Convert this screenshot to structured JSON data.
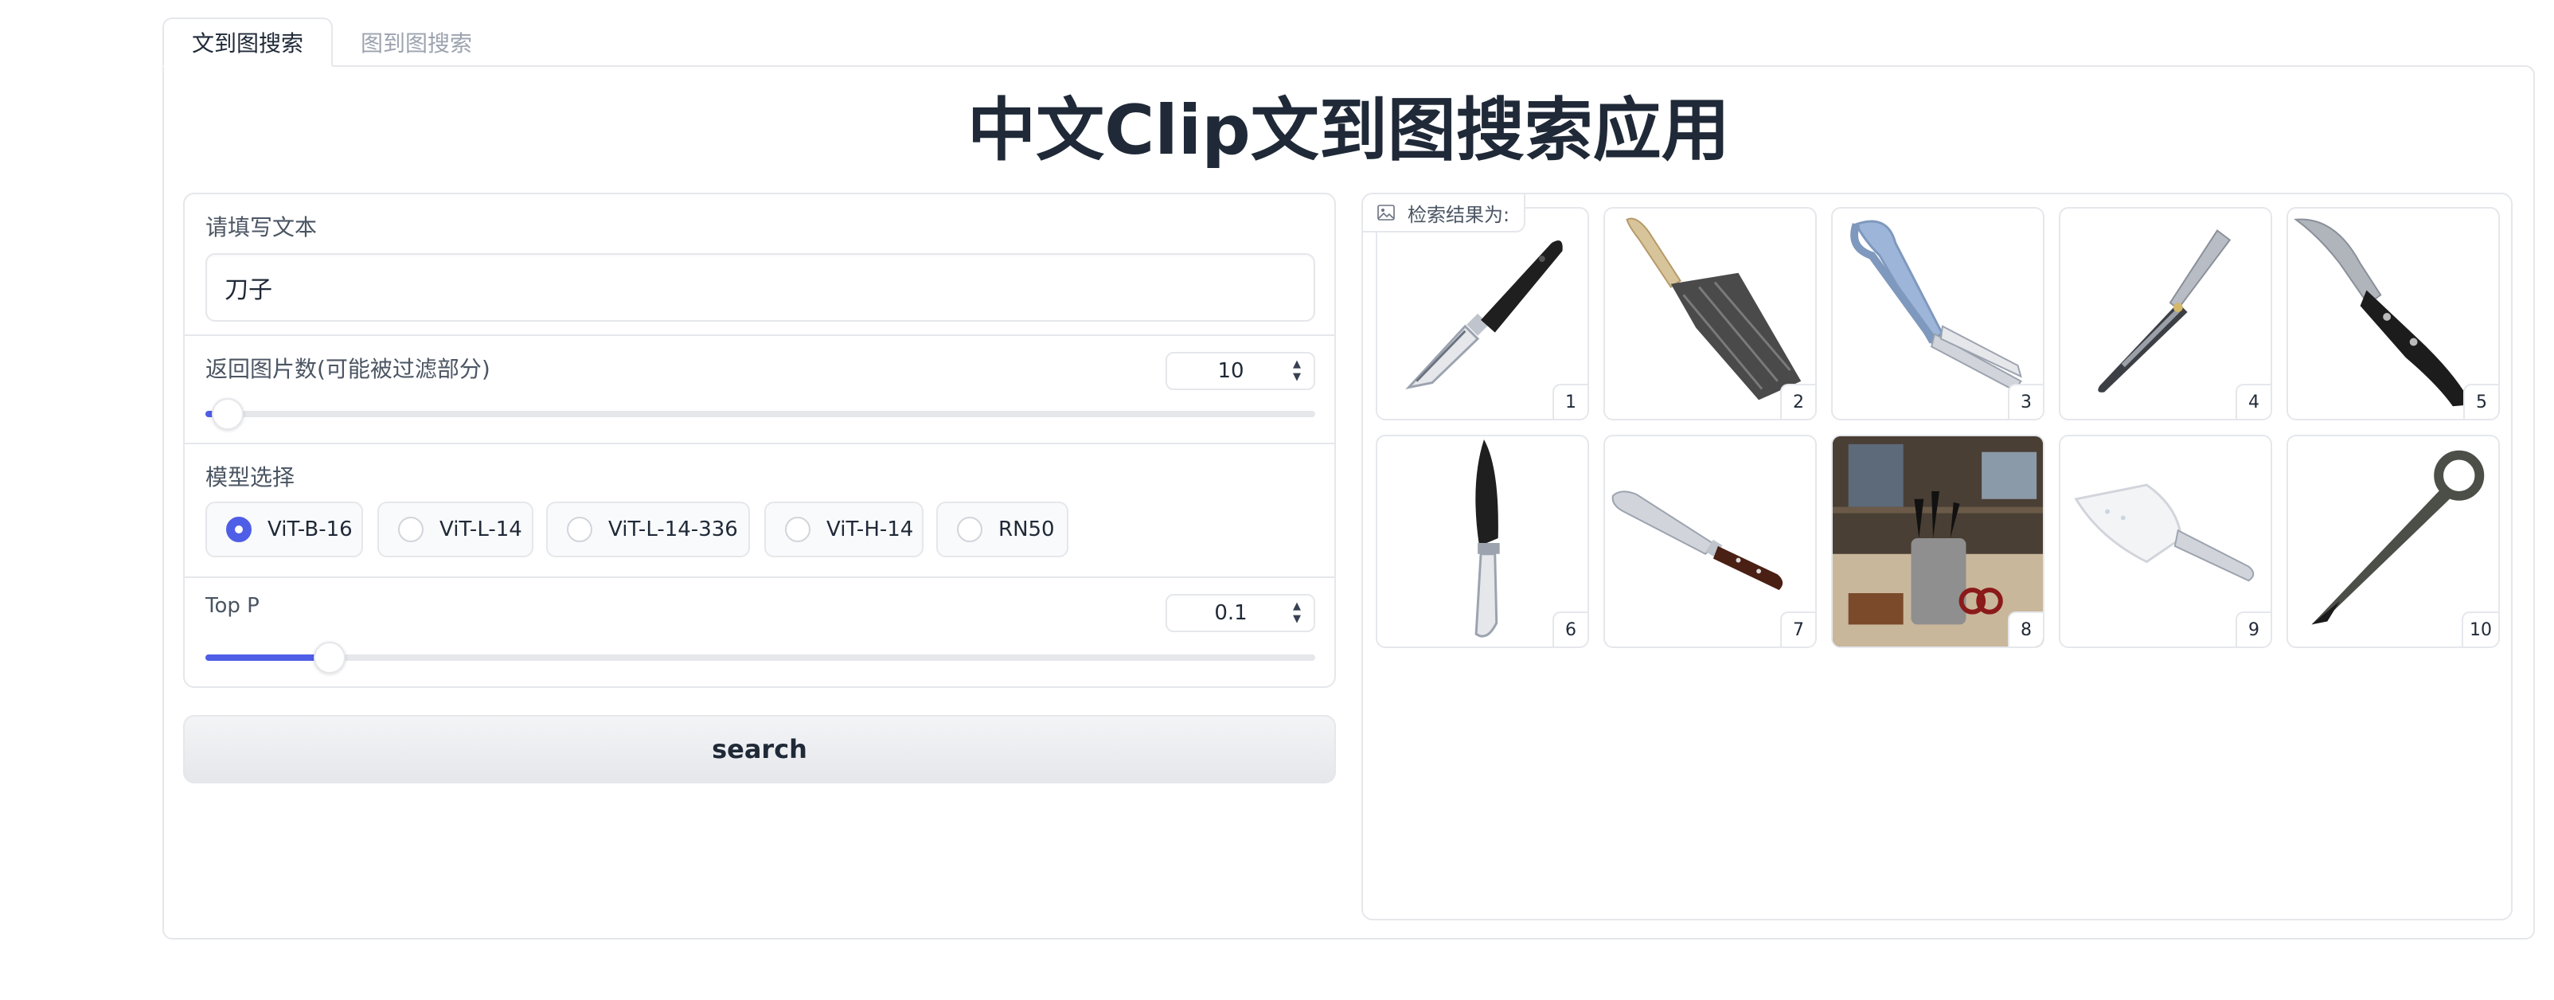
{
  "tabs": [
    {
      "label": "文到图搜索",
      "active": true
    },
    {
      "label": "图到图搜索",
      "active": false
    }
  ],
  "page_title": "中文Clip文到图搜索应用",
  "text_query": {
    "label": "请填写文本",
    "value": "刀子"
  },
  "num_images": {
    "label": "返回图片数(可能被过滤部分)",
    "value": "10",
    "slider_fraction": 0.01
  },
  "model_select": {
    "label": "模型选择",
    "options": [
      "ViT-B-16",
      "ViT-L-14",
      "ViT-L-14-336",
      "ViT-H-14",
      "RN50"
    ],
    "selected": "ViT-B-16"
  },
  "top_p": {
    "label": "Top P",
    "value": "0.1",
    "slider_fraction": 0.1
  },
  "search_button": "search",
  "gallery": {
    "label": "检索结果为:",
    "items": [
      {
        "index": "1",
        "icon": "peeler-knife-icon"
      },
      {
        "index": "2",
        "icon": "damascus-cleaver-icon"
      },
      {
        "index": "3",
        "icon": "thread-snips-icon"
      },
      {
        "index": "4",
        "icon": "folding-knife-icon"
      },
      {
        "index": "5",
        "icon": "curved-knife-icon"
      },
      {
        "index": "6",
        "icon": "vertical-peeler-icon"
      },
      {
        "index": "7",
        "icon": "butcher-knife-icon"
      },
      {
        "index": "8",
        "icon": "knife-block-photo-icon"
      },
      {
        "index": "9",
        "icon": "serrated-spatula-icon"
      },
      {
        "index": "10",
        "icon": "ring-knife-icon"
      }
    ]
  },
  "colors": {
    "accent": "#4f5ee6",
    "border": "#e5e7eb",
    "text": "#1f2937",
    "muted": "#9ca3af"
  }
}
